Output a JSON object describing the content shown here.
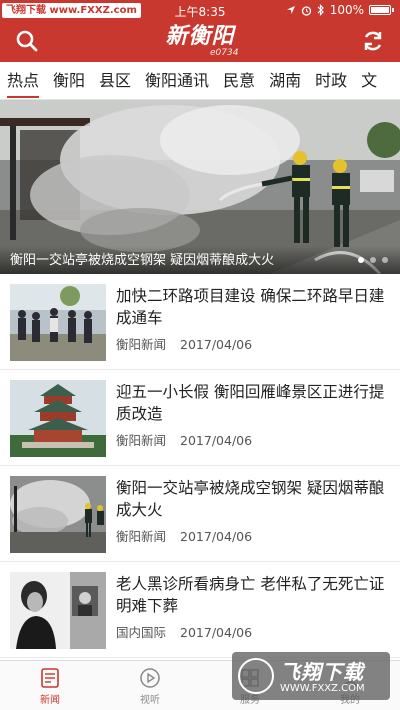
{
  "status_bar": {
    "carrier_badge": "飞翔下载 www.FXXZ.com",
    "time": "上午8:35",
    "battery": "100%"
  },
  "header": {
    "logo_main": "新衡阳",
    "logo_sub": "e0734"
  },
  "tabs": [
    {
      "label": "热点",
      "active": true
    },
    {
      "label": "衡阳",
      "active": false
    },
    {
      "label": "县区",
      "active": false
    },
    {
      "label": "衡阳通讯",
      "active": false
    },
    {
      "label": "民意",
      "active": false
    },
    {
      "label": "湖南",
      "active": false
    },
    {
      "label": "时政",
      "active": false
    },
    {
      "label": "文",
      "active": false
    }
  ],
  "carousel": {
    "caption": "衡阳一交站亭被烧成空钢架 疑因烟蒂酿成大火",
    "dot_count": 3,
    "active_dot": 0
  },
  "news": [
    {
      "title": "加快二环路项目建设 确保二环路早日建成通车",
      "source": "衡阳新闻",
      "date": "2017/04/06",
      "thumb": "meeting"
    },
    {
      "title": "迎五一小长假 衡阳回雁峰景区正进行提质改造",
      "source": "衡阳新闻",
      "date": "2017/04/06",
      "thumb": "pavilion"
    },
    {
      "title": "衡阳一交站亭被烧成空钢架 疑因烟蒂酿成大火",
      "source": "衡阳新闻",
      "date": "2017/04/06",
      "thumb": "fire"
    },
    {
      "title": "老人黑诊所看病身亡 老伴私了无死亡证明难下葬",
      "source": "国内国际",
      "date": "2017/04/06",
      "thumb": "elder"
    }
  ],
  "bottom_nav": [
    {
      "label": "新闻",
      "icon": "news-icon",
      "active": true
    },
    {
      "label": "视听",
      "icon": "play-icon",
      "active": false
    },
    {
      "label": "服务",
      "icon": "service-icon",
      "active": false
    },
    {
      "label": "我的",
      "icon": "profile-icon",
      "active": false
    }
  ],
  "watermark": {
    "title": "飞翔下载",
    "url": "WWW.FXXZ.COM"
  },
  "colors": {
    "brand": "#c8382e"
  }
}
